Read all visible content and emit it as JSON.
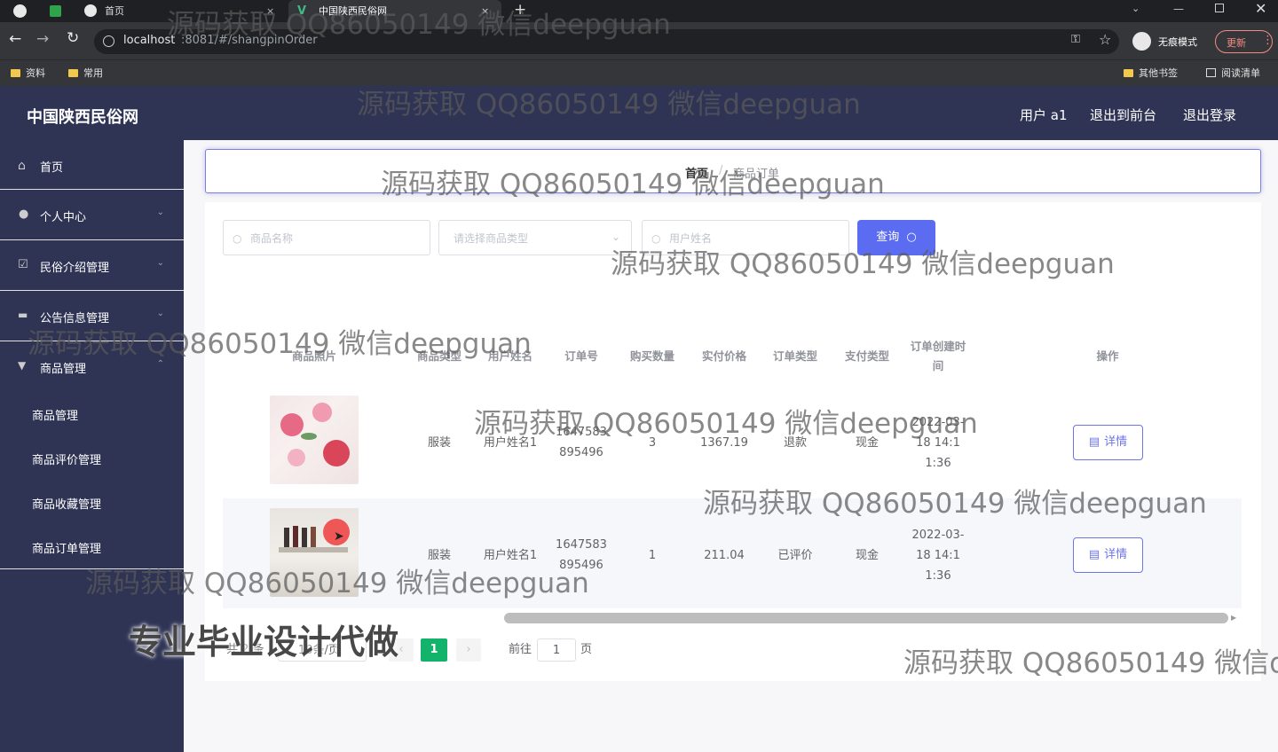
{
  "browser": {
    "tabs": [
      {
        "label": "首页"
      },
      {
        "label": "中国陕西民俗网"
      }
    ],
    "new_tab": "+",
    "url_host": "localhost",
    "url_rest": ":8081/#/shangpinOrder",
    "incognito_label": "无痕模式",
    "update_label": "更新",
    "bookmarks": [
      {
        "label": "资料"
      },
      {
        "label": "常用"
      }
    ],
    "other_bookmarks": "其他书签",
    "reading_list": "阅读清单"
  },
  "header": {
    "brand": "中国陕西民俗网",
    "user": "用户 a1",
    "to_front": "退出到前台",
    "logout": "退出登录"
  },
  "sidebar": {
    "items": [
      {
        "label": "首页",
        "icon": "home-icon"
      },
      {
        "label": "个人中心",
        "icon": "user-icon"
      },
      {
        "label": "民俗介绍管理",
        "icon": "check-square-icon"
      },
      {
        "label": "公告信息管理",
        "icon": "message-icon"
      },
      {
        "label": "商品管理",
        "icon": "goods-icon"
      }
    ],
    "sub_items": [
      {
        "label": "商品管理"
      },
      {
        "label": "商品评价管理"
      },
      {
        "label": "商品收藏管理"
      },
      {
        "label": "商品订单管理"
      }
    ]
  },
  "breadcrumb": {
    "home": "首页",
    "sep": "/",
    "current": "商品订单"
  },
  "search": {
    "name_placeholder": "商品名称",
    "type_placeholder": "请选择商品类型",
    "user_placeholder": "用户姓名",
    "query_label": "查询"
  },
  "table": {
    "headers": [
      "商品照片",
      "商品类型",
      "用户姓名",
      "订单号",
      "购买数量",
      "实付价格",
      "订单类型",
      "支付类型",
      "订单创建时间",
      "操作"
    ],
    "rows": [
      {
        "type": "服装",
        "user": "用户姓名1",
        "order_no": "1647583895496",
        "qty": "3",
        "price": "1367.19",
        "order_type": "退款",
        "pay_type": "现金",
        "created": "2022-03-18 14:11:36",
        "action": "详情"
      },
      {
        "type": "服装",
        "user": "用户姓名1",
        "order_no": "1647583895496",
        "qty": "1",
        "price": "211.04",
        "order_type": "已评价",
        "pay_type": "现金",
        "created": "2022-03-18 14:11:36",
        "action": "详情"
      }
    ]
  },
  "pagination": {
    "total": "共 2 条",
    "page_size": "10条/页",
    "current_page": "1",
    "goto_label": "前往",
    "goto_value": "1",
    "page_unit": "页"
  },
  "watermarks": {
    "text": "源码获取 QQ86050149 微信deepguan",
    "text_cut": "源码获取 QQ86050149 微信de",
    "slogan": "专业毕业设计代做"
  }
}
